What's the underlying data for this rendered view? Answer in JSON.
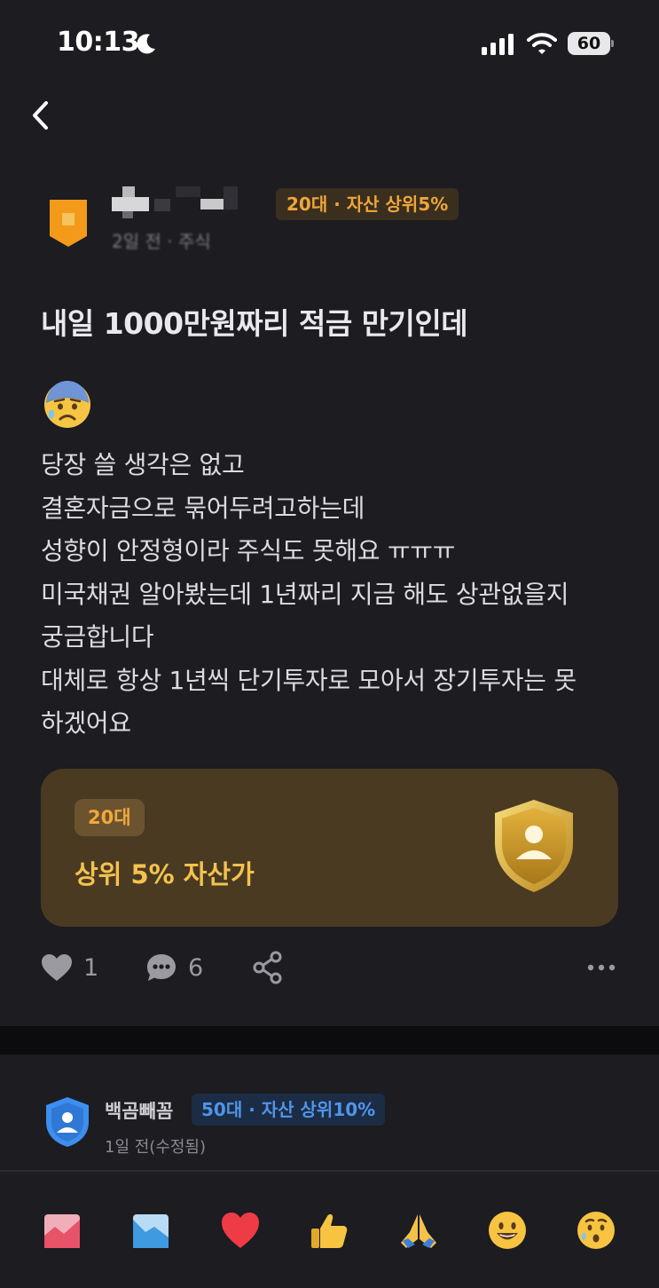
{
  "status": {
    "time": "10:13",
    "battery": "60",
    "moon_icon": "moon-icon",
    "signal_icon": "cellular-signal-icon",
    "wifi_icon": "wifi-icon"
  },
  "nav": {
    "back_icon": "chevron-left-icon"
  },
  "post": {
    "author": {
      "badge_icon": "orange-shield-badge-icon",
      "tag": "20대 · 자산 상위5%",
      "meta": "2일 전 · 주식"
    },
    "title": "내일 1000만원짜리 적금 만기인데",
    "emoji": "anxious-face-with-sweat-icon",
    "body_lines": [
      "당장 쓸 생각은 없고",
      "결혼자금으로 묶어두려고하는데",
      "성향이 안정형이라 주식도 못해요 ㅠㅠㅠ",
      "미국채권 알아봤는데 1년짜리 지금 해도 상관없을지",
      "궁금합니다",
      "대체로 항상 1년씩 단기투자로 모아서 장기투자는 못",
      "하겠어요"
    ],
    "rank_card": {
      "age": "20대",
      "text": "상위 5% 자산가",
      "shield_icon": "gold-shield-person-icon",
      "bg_color": "#4a3a22",
      "accent_color": "#f4c24e"
    },
    "actions": {
      "likes": "1",
      "comments": "6",
      "like_icon": "heart-icon",
      "comment_icon": "speech-bubble-icon",
      "share_icon": "share-icon",
      "more_icon": "more-horizontal-icon"
    }
  },
  "comment": {
    "name": "백곰빼꼼",
    "tag": "50대 · 자산 상위10%",
    "meta": "1일 전(수정됨)",
    "avatar_icon": "blue-shield-person-icon"
  },
  "reactions": [
    {
      "icon": "chart-up-icon"
    },
    {
      "icon": "chart-down-icon"
    },
    {
      "icon": "red-heart-icon"
    },
    {
      "icon": "thumbs-up-icon"
    },
    {
      "icon": "folded-hands-icon"
    },
    {
      "icon": "grinning-face-icon"
    },
    {
      "icon": "thinking-face-icon"
    }
  ]
}
